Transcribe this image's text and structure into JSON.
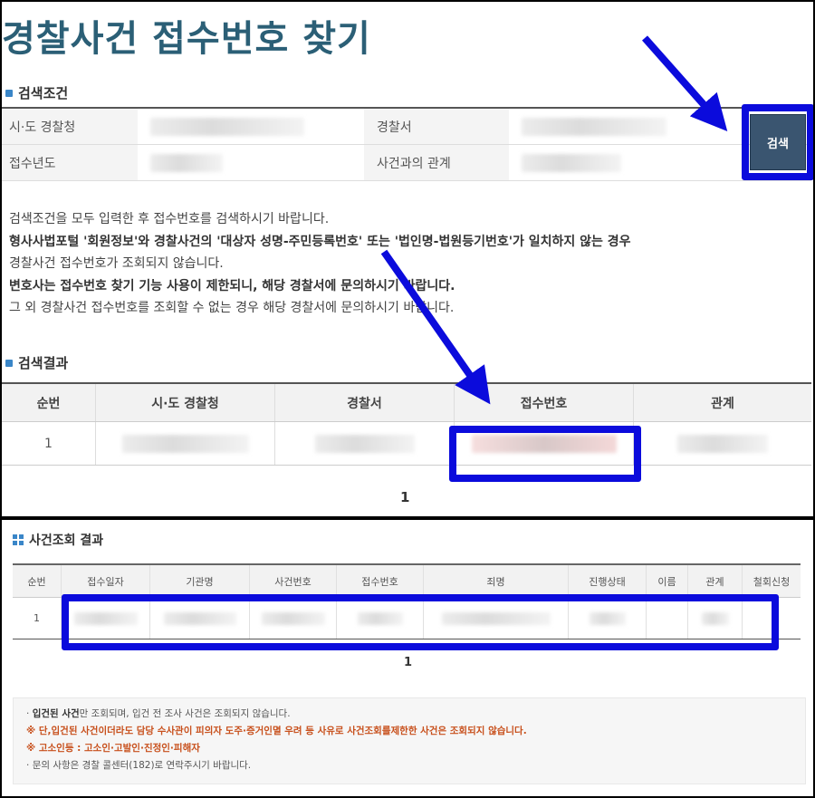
{
  "top": {
    "title": "경찰사건 접수번호 찾기",
    "conditions_heading": "검색조건",
    "conditions": [
      {
        "label": "시·도 경찰청",
        "label2": "경찰서"
      },
      {
        "label": "접수년도",
        "label2": "사건과의 관계"
      }
    ],
    "search_button": "검색",
    "notes": [
      "검색조건을 모두 입력한 후 접수번호를 검색하시기 바랍니다.",
      "형사사법포털 '회원정보'와 경찰사건의 '대상자 성명-주민등록번호' 또는 '법인명-법원등기번호'가 일치하지 않는 경우",
      "경찰사건 접수번호가 조회되지 않습니다.",
      "변호사는 접수번호 찾기 기능 사용이 제한되니, 해당 경찰서에 문의하시기 바랍니다.",
      "그 외 경찰사건 접수번호를 조회할 수 없는 경우 해당 경찰서에 문의하시기 바랍니다."
    ],
    "results_heading": "검색결과",
    "results_columns": [
      "순번",
      "시·도 경찰청",
      "경찰서",
      "접수번호",
      "관계"
    ],
    "results_rows": [
      {
        "no": "1"
      }
    ],
    "page": "1"
  },
  "bottom": {
    "heading": "사건조회 결과",
    "columns": [
      "순번",
      "접수일자",
      "기관명",
      "사건번호",
      "접수번호",
      "죄명",
      "진행상태",
      "이름",
      "관계",
      "철회신청"
    ],
    "rows": [
      {
        "no": "1"
      }
    ],
    "page": "1",
    "notes": {
      "line1_bold": "입건된 사건",
      "line1_rest": "만 조회되며, 입건 전 조사 사건은 조회되지 않습니다.",
      "line2": "※ 단,입건된 사건이더라도 담당 수사관이 피의자 도주·증거인멸 우려 등 사유로 사건조회를제한한 사건은 조회되지 않습니다.",
      "line3": "※ 고소인등 : 고소인·고발인·진정인·피해자",
      "line4": "문의 사항은 경찰 콜센터(182)로 연락주시기 바랍니다."
    }
  },
  "colors": {
    "highlight": "#0b0bdc",
    "title": "#2b5f76",
    "button": "#3a5570"
  }
}
